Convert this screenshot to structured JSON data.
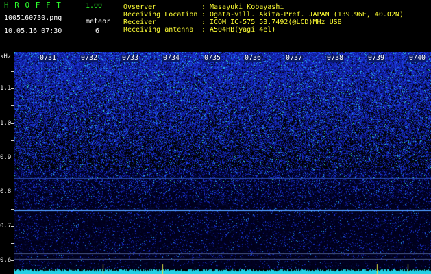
{
  "app": {
    "name": "H R O F F T",
    "version": "1.00",
    "filename": "1005160730.png",
    "datetime": "10.05.16 07:30",
    "type_label": "meteor",
    "count": "6"
  },
  "info": {
    "labels": [
      "Ovserver",
      "Receiving Location",
      "Receiver",
      "Receiving antenna"
    ],
    "separators": [
      ":",
      ":",
      ":",
      ":"
    ],
    "values": [
      "Masayuki Kobayashi",
      "Ogata-vill. Akita-Pref. JAPAN (139.96E, 40.02N)",
      "ICOM IC-575 53.7492(@LCD)MHz USB",
      "A504HB(yagi 4el)"
    ]
  },
  "axis": {
    "unit": "kHz",
    "ticks": [
      "1.1",
      "1.0",
      "0.9",
      "0.8",
      "0.7",
      "0.6"
    ]
  },
  "time_labels": [
    "0731",
    "0732",
    "0733",
    "0734",
    "0735",
    "0736",
    "0737",
    "0738",
    "0739",
    "0740"
  ],
  "colors": {
    "header_green": "#2cff2c",
    "header_text": "#ffffff",
    "info_yellow": "#ffff33",
    "background": "#000000",
    "carrier_line": "#4f9cff",
    "baseline_noise": "#24d0e6"
  }
}
